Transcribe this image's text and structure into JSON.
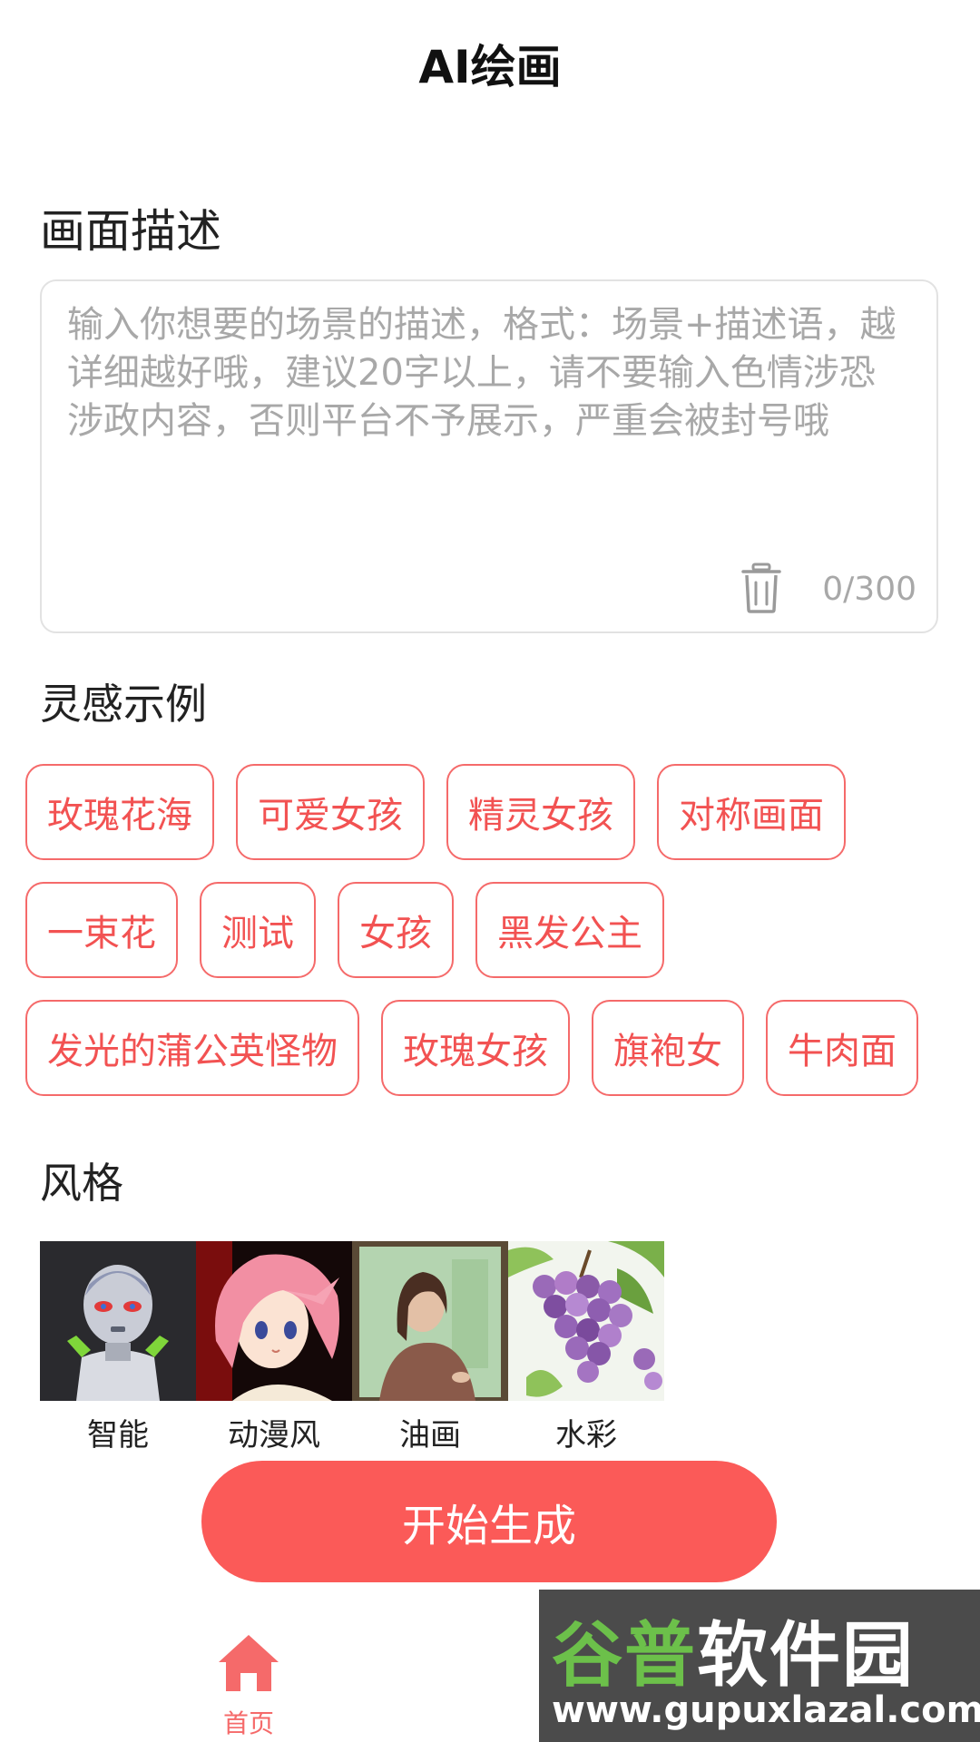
{
  "header": {
    "title": "AI绘画"
  },
  "description": {
    "section_title": "画面描述",
    "value": "",
    "placeholder": "输入你想要的场景的描述，格式：场景+描述语，越详细越好哦，建议20字以上，请不要输入色情涉恐涉政内容，否则平台不予展示，严重会被封号哦",
    "counter": "0/300",
    "clear_icon": "trash-icon"
  },
  "inspiration": {
    "section_title": "灵感示例",
    "rows": [
      [
        "玫瑰花海",
        "可爱女孩",
        "精灵女孩",
        "对称画面"
      ],
      [
        "一束花",
        "测试",
        "女孩",
        "黑发公主"
      ],
      [
        "发光的蒲公英怪物",
        "玫瑰女孩",
        "旗袍女",
        "牛肉面"
      ]
    ]
  },
  "style": {
    "section_title": "风格",
    "items": [
      {
        "label": "智能",
        "thumb": "robot-thumbnail"
      },
      {
        "label": "动漫风",
        "thumb": "anime-girl-thumbnail"
      },
      {
        "label": "油画",
        "thumb": "oil-painting-thumbnail"
      },
      {
        "label": "水彩",
        "thumb": "watercolor-grapes-thumbnail"
      }
    ]
  },
  "generate_button": {
    "label": "开始生成"
  },
  "tabbar": {
    "home": {
      "label": "首页",
      "icon": "home-icon"
    }
  },
  "watermark": {
    "left": "谷普",
    "right": "软件园",
    "url": "www.gupuxlazal.com"
  },
  "colors": {
    "accent": "#fb5a58",
    "tag_border": "#f56a6a",
    "tag_text": "#f25252",
    "placeholder": "#a8a8a8"
  }
}
